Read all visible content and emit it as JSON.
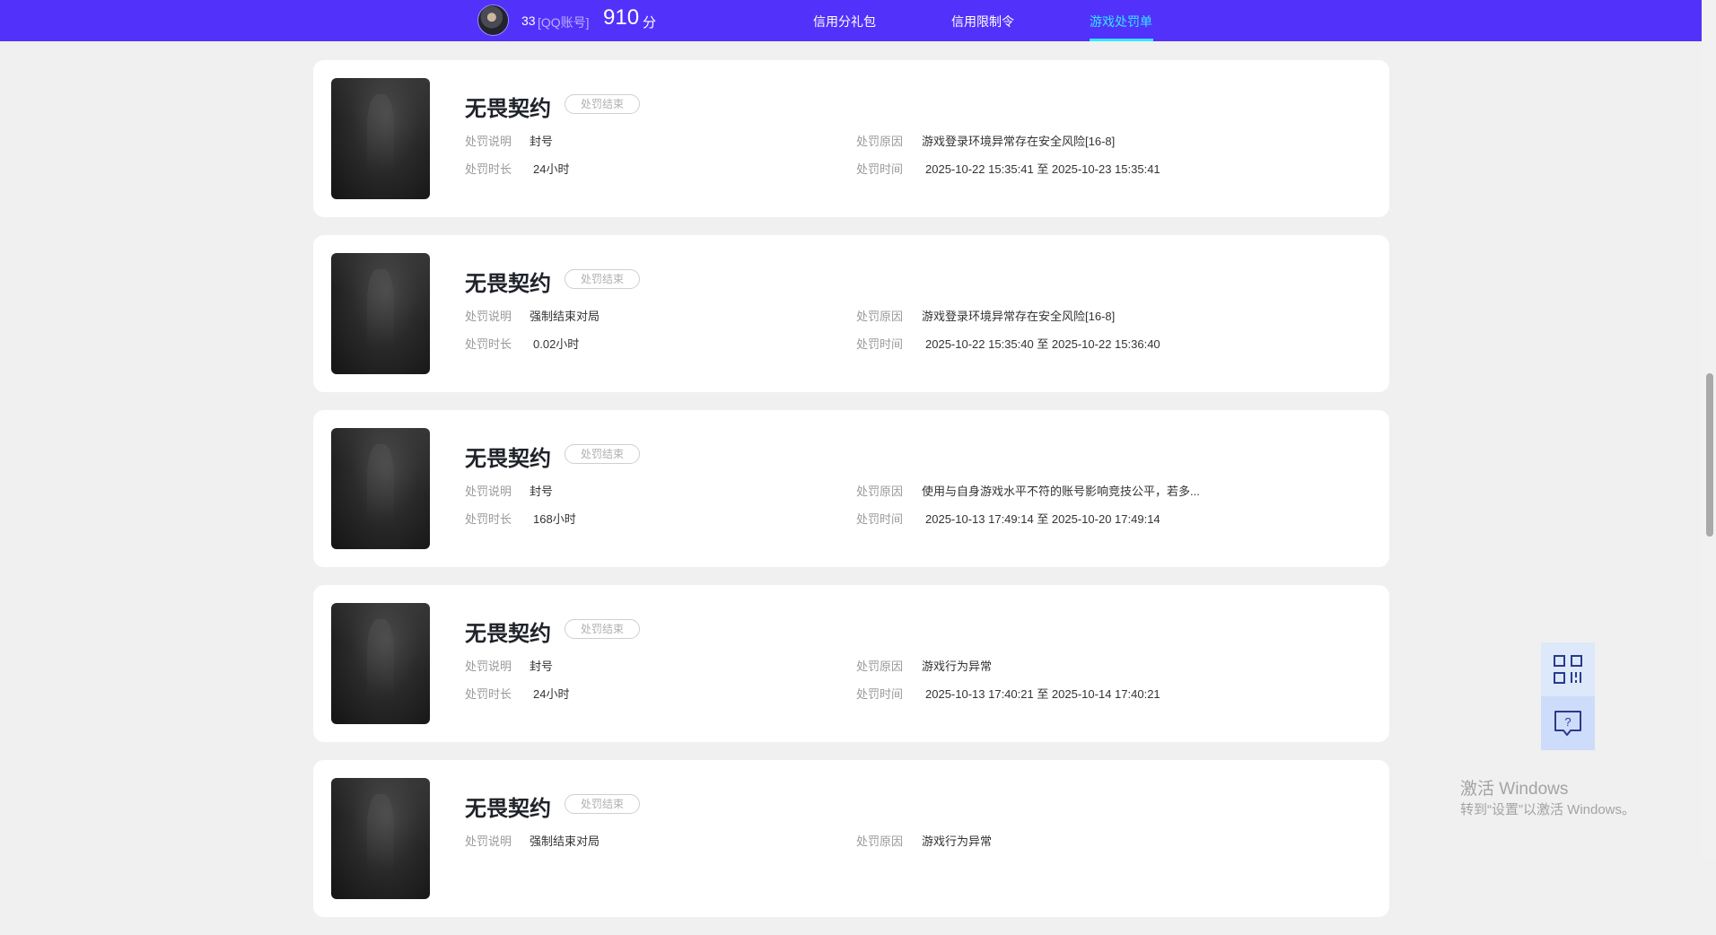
{
  "header": {
    "user_id": "33",
    "account_type": "[QQ账号]",
    "score": "910",
    "score_unit": "分",
    "nav": [
      {
        "label": "信用分礼包"
      },
      {
        "label": "信用限制令"
      },
      {
        "label": "游戏处罚单",
        "active": true
      }
    ],
    "accent_color": "#5232fa",
    "active_color": "#34e6ff"
  },
  "labels": {
    "desc": "处罚说明",
    "duration": "处罚时长",
    "reason": "处罚原因",
    "time": "处罚时间"
  },
  "records": [
    {
      "game": "无畏契约",
      "status": "处罚结束",
      "description": "封号",
      "duration": "24小时",
      "reason": "游戏登录环境异常存在安全风险[16-8]",
      "time": "2025-10-22 15:35:41 至 2025-10-23 15:35:41"
    },
    {
      "game": "无畏契约",
      "status": "处罚结束",
      "description": "强制结束对局",
      "duration": "0.02小时",
      "reason": "游戏登录环境异常存在安全风险[16-8]",
      "time": "2025-10-22 15:35:40 至 2025-10-22 15:36:40"
    },
    {
      "game": "无畏契约",
      "status": "处罚结束",
      "description": "封号",
      "duration": "168小时",
      "reason": "使用与自身游戏水平不符的账号影响竞技公平，若多...",
      "time": "2025-10-13 17:49:14 至 2025-10-20 17:49:14"
    },
    {
      "game": "无畏契约",
      "status": "处罚结束",
      "description": "封号",
      "duration": "24小时",
      "reason": "游戏行为异常",
      "time": "2025-10-13 17:40:21 至 2025-10-14 17:40:21"
    },
    {
      "game": "无畏契约",
      "status": "处罚结束",
      "description": "强制结束对局",
      "duration": "",
      "reason": "游戏行为异常",
      "time": ""
    }
  ],
  "floating": {
    "qr_icon": "qr-code-icon",
    "help_icon": "help-chat-icon"
  },
  "watermark": {
    "line1": "激活 Windows",
    "line2": "转到“设置”以激活 Windows。"
  }
}
